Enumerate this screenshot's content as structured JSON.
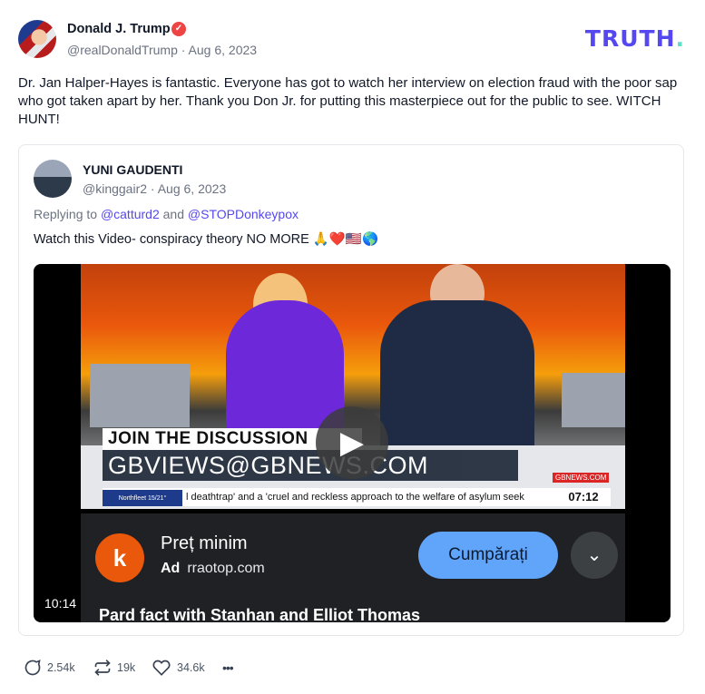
{
  "post": {
    "author_name": "Donald J. Trump",
    "handle": "@realDonaldTrump",
    "separator": "·",
    "date": "Aug 6, 2023",
    "text": "Dr. Jan Halper-Hayes is fantastic. Everyone has got to watch her interview on election fraud with the poor sap who got taken apart by her. Thank you Don Jr. for putting this masterpiece out for the public to see. WITCH HUNT!",
    "verified_icon": "check-badge-icon"
  },
  "logo": {
    "text": "TRUTH",
    "dot": ".",
    "color": "#5448ee"
  },
  "quote": {
    "author_name": "YUNI GAUDENTI",
    "handle": "@kinggair2",
    "separator": "·",
    "date": "Aug 6, 2023",
    "replying_prefix": "Replying to",
    "mention1": "@catturd2",
    "and": "and",
    "mention2": "@STOPDonkeypox",
    "text": "Watch this Video- conspiracy theory NO MORE 🙏❤️🇺🇸🌎"
  },
  "video": {
    "banner_top": "JOIN THE DISCUSSION",
    "banner_email": "GBVIEWS@GBNEWS.COM",
    "ticker_badge": "Northfleet 15/21°",
    "ticker_text": "l deathtrap' and a 'cruel and reckless approach to the welfare of asylum seek",
    "clock": "07:12",
    "channel": "GBNEWS.COM",
    "ad_icon_letter": "k",
    "ad_title": "Preț minim",
    "ad_label": "Ad",
    "ad_domain": "rraotop.com",
    "ad_cta": "Cumpărați",
    "ad_bottom": "Pard fact with Stanhan and Elliot Thomas",
    "duration": "10:14"
  },
  "actions": {
    "replies": "2.54k",
    "retruths": "19k",
    "likes": "34.6k",
    "more": "•••"
  }
}
